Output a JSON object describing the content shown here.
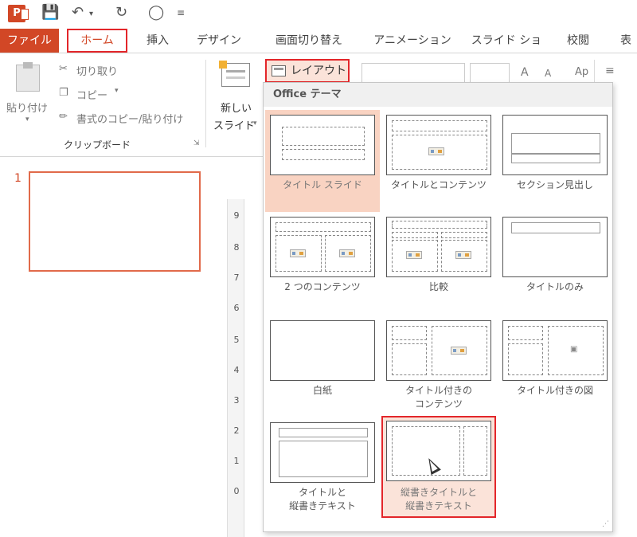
{
  "qat": {
    "app_logo": "P",
    "save_icon": "save-icon",
    "undo_icon": "undo-icon",
    "redo_icon": "redo-icon",
    "present_icon": "present-icon"
  },
  "tabs": [
    "ファイル",
    "ホーム",
    "挿入",
    "デザイン",
    "画面切り替え",
    "アニメーション",
    "スライド ショー",
    "校閲",
    "表"
  ],
  "clipboard": {
    "paste_label": "貼り付け",
    "cut_label": "切り取り",
    "copy_label": "コピー",
    "format_painter_label": "書式のコピー/貼り付け",
    "group_label": "クリップボード"
  },
  "slides": {
    "new_slide_line1": "新しい",
    "new_slide_line2": "スライド",
    "layout_label": "レイアウト"
  },
  "font": {
    "grow_label": "A",
    "shrink_label": "A",
    "clear_label": "Ap"
  },
  "thumbnail": {
    "number": "1"
  },
  "ruler": [
    "9",
    "8",
    "7",
    "6",
    "5",
    "4",
    "3",
    "2",
    "1",
    "0"
  ],
  "gallery": {
    "header": "Office テーマ",
    "layouts": [
      {
        "name": "タイトル スライド"
      },
      {
        "name": "タイトルとコンテンツ"
      },
      {
        "name": "セクション見出し"
      },
      {
        "name": "2 つのコンテンツ"
      },
      {
        "name": "比較"
      },
      {
        "name": "タイトルのみ"
      },
      {
        "name": "白紙"
      },
      {
        "name_line1": "タイトル付きの",
        "name_line2": "コンテンツ"
      },
      {
        "name": "タイトル付きの図"
      },
      {
        "name_line1": "タイトルと",
        "name_line2": "縦書きテキスト"
      },
      {
        "name_line1": "縦書きタイトルと",
        "name_line2": "縦書きテキスト"
      }
    ]
  },
  "colors": {
    "accent": "#d24726",
    "highlight_border": "#e3262a",
    "selected_bg": "#f9d3c2"
  }
}
